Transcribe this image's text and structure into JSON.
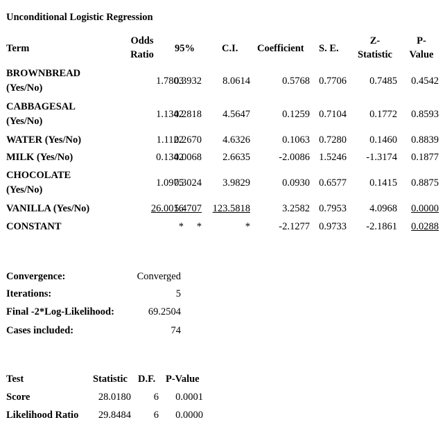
{
  "title": "Unconditional Logistic Regression",
  "coef_table": {
    "headers": {
      "term": "Term",
      "odds_ratio_1": "Odds",
      "odds_ratio_2": "Ratio",
      "ci_low": "95%",
      "ci_high": "C.I.",
      "coefficient": "Coefficient",
      "se": "S. E.",
      "z_1": "Z-",
      "z_2": "Statistic",
      "p_1": "P-",
      "p_2": "Value"
    },
    "rows": [
      {
        "term_1": "BROWNBREAD",
        "term_2": "(Yes/No)",
        "odds_ratio": "1.7803",
        "ci_low": "0.3932",
        "ci_high": "8.0614",
        "coefficient": "0.5768",
        "se": "0.7706",
        "z": "0.7485",
        "p": "0.4542"
      },
      {
        "term_1": "CABBAGESAL",
        "term_2": "(Yes/No)",
        "odds_ratio": "1.1342",
        "ci_low": "0.2818",
        "ci_high": "4.5647",
        "coefficient": "0.1259",
        "se": "0.7104",
        "z": "0.1772",
        "p": "0.8593"
      },
      {
        "term_1": "WATER (Yes/No)",
        "term_2": "",
        "odds_ratio": "1.1122",
        "ci_low": "0.2670",
        "ci_high": "4.6326",
        "coefficient": "0.1063",
        "se": "0.7280",
        "z": "0.1460",
        "p": "0.8839"
      },
      {
        "term_1": "MILK (Yes/No)",
        "term_2": "",
        "odds_ratio": "0.1342",
        "ci_low": "0.0068",
        "ci_high": "2.6635",
        "coefficient": "-2.0086",
        "se": "1.5246",
        "z": "-1.3174",
        "p": "0.1877"
      },
      {
        "term_1": "CHOCOLATE",
        "term_2": "(Yes/No)",
        "odds_ratio": "1.0975",
        "ci_low": "0.3024",
        "ci_high": "3.9829",
        "coefficient": "0.0930",
        "se": "0.6577",
        "z": "0.1415",
        "p": "0.8875"
      },
      {
        "term_1": "VANILLA (Yes/No)",
        "term_2": "",
        "odds_ratio": "26.0016",
        "ci_low": "5.4707",
        "ci_high": "123.5818",
        "coefficient": "3.2582",
        "se": "0.7953",
        "z": "4.0968",
        "p": "0.0000"
      },
      {
        "term_1": "CONSTANT",
        "term_2": "",
        "odds_ratio": "*",
        "ci_low": "*",
        "ci_high": "*",
        "coefficient": "-2.1277",
        "se": "0.9733",
        "z": "-2.1861",
        "p": "0.0288"
      }
    ]
  },
  "summary": [
    {
      "label": "Convergence:",
      "value": "Converged"
    },
    {
      "label": "Iterations:",
      "value": "5"
    },
    {
      "label": "Final -2*Log-Likelihood:",
      "value": "69.2504"
    },
    {
      "label": "Cases included:",
      "value": "74"
    }
  ],
  "test_table": {
    "headers": {
      "test": "Test",
      "statistic": "Statistic",
      "df": "D.F.",
      "p": "P-Value"
    },
    "rows": [
      {
        "test": "Score",
        "statistic": "28.0180",
        "df": "6",
        "p": "0.0001"
      },
      {
        "test": "Likelihood Ratio",
        "statistic": "29.8484",
        "df": "6",
        "p": "0.0000"
      }
    ]
  }
}
